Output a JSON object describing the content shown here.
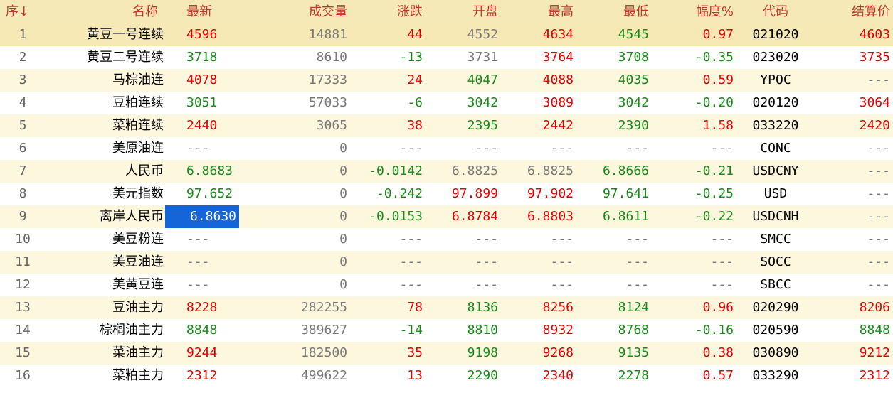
{
  "headers": [
    "序↓",
    "名称",
    "最新",
    "成交量",
    "涨跌",
    "开盘",
    "最高",
    "最低",
    "幅度%",
    "代码",
    "结算价"
  ],
  "colors": {
    "up": "#e60000",
    "down": "#1a8a1a",
    "neutral": "#7a7a7a",
    "header": "#c0392b",
    "selected": "#1565d8"
  },
  "rows": [
    {
      "seq": "1",
      "name": "黄豆一号连续",
      "latest": "4596",
      "volume": "14881",
      "change": "44",
      "open": "4552",
      "high": "4634",
      "low": "4545",
      "range": "0.97",
      "code": "021020",
      "settle": "4603",
      "c": {
        "latest": "red",
        "change": "red",
        "open": "gray",
        "high": "red",
        "low": "green",
        "range": "red",
        "settle": "red"
      }
    },
    {
      "seq": "2",
      "name": "黄豆二号连续",
      "latest": "3718",
      "volume": "8610",
      "change": "-13",
      "open": "3731",
      "high": "3764",
      "low": "3708",
      "range": "-0.35",
      "code": "023020",
      "settle": "3735",
      "c": {
        "latest": "green",
        "change": "green",
        "open": "gray",
        "high": "red",
        "low": "green",
        "range": "green",
        "settle": "red"
      }
    },
    {
      "seq": "3",
      "name": "马棕油连",
      "latest": "4078",
      "volume": "17333",
      "change": "24",
      "open": "4047",
      "high": "4088",
      "low": "4035",
      "range": "0.59",
      "code": "YPOC",
      "settle": "---",
      "c": {
        "latest": "red",
        "change": "red",
        "open": "green",
        "high": "red",
        "low": "green",
        "range": "red",
        "settle": "gray"
      }
    },
    {
      "seq": "4",
      "name": "豆粕连续",
      "latest": "3051",
      "volume": "57033",
      "change": "-6",
      "open": "3042",
      "high": "3089",
      "low": "3042",
      "range": "-0.20",
      "code": "020120",
      "settle": "3064",
      "c": {
        "latest": "green",
        "change": "green",
        "open": "green",
        "high": "red",
        "low": "green",
        "range": "green",
        "settle": "red"
      }
    },
    {
      "seq": "5",
      "name": "菜粕连续",
      "latest": "2440",
      "volume": "3065",
      "change": "38",
      "open": "2395",
      "high": "2442",
      "low": "2390",
      "range": "1.58",
      "code": "033220",
      "settle": "2420",
      "c": {
        "latest": "red",
        "change": "red",
        "open": "green",
        "high": "red",
        "low": "green",
        "range": "red",
        "settle": "red"
      }
    },
    {
      "seq": "6",
      "name": "美原油连",
      "latest": "---",
      "volume": "0",
      "change": "---",
      "open": "---",
      "high": "---",
      "low": "---",
      "range": "---",
      "code": "CONC",
      "settle": "---",
      "c": {
        "latest": "gray",
        "change": "gray",
        "open": "gray",
        "high": "gray",
        "low": "gray",
        "range": "gray",
        "settle": "gray"
      }
    },
    {
      "seq": "7",
      "name": "人民币",
      "latest": "6.8683",
      "volume": "0",
      "change": "-0.0142",
      "open": "6.8825",
      "high": "6.8825",
      "low": "6.8666",
      "range": "-0.21",
      "code": "USDCNY",
      "settle": "---",
      "c": {
        "latest": "green",
        "change": "green",
        "open": "gray",
        "high": "gray",
        "low": "green",
        "range": "green",
        "settle": "gray"
      }
    },
    {
      "seq": "8",
      "name": "美元指数",
      "latest": "97.652",
      "volume": "0",
      "change": "-0.242",
      "open": "97.899",
      "high": "97.902",
      "low": "97.641",
      "range": "-0.25",
      "code": "USD",
      "settle": "---",
      "c": {
        "latest": "green",
        "change": "green",
        "open": "red",
        "high": "red",
        "low": "green",
        "range": "green",
        "settle": "gray"
      }
    },
    {
      "seq": "9",
      "name": "离岸人民币",
      "latest": "6.8630",
      "volume": "0",
      "change": "-0.0153",
      "open": "6.8784",
      "high": "6.8803",
      "low": "6.8611",
      "range": "-0.22",
      "code": "USDCNH",
      "settle": "---",
      "c": {
        "latest": "hl",
        "change": "green",
        "open": "red",
        "high": "red",
        "low": "green",
        "range": "green",
        "settle": "gray"
      }
    },
    {
      "seq": "10",
      "name": "美豆粉连",
      "latest": "---",
      "volume": "0",
      "change": "---",
      "open": "---",
      "high": "---",
      "low": "---",
      "range": "---",
      "code": "SMCC",
      "settle": "---",
      "c": {
        "latest": "gray",
        "change": "gray",
        "open": "gray",
        "high": "gray",
        "low": "gray",
        "range": "gray",
        "settle": "gray"
      }
    },
    {
      "seq": "11",
      "name": "美豆油连",
      "latest": "---",
      "volume": "0",
      "change": "---",
      "open": "---",
      "high": "---",
      "low": "---",
      "range": "---",
      "code": "SOCC",
      "settle": "---",
      "c": {
        "latest": "gray",
        "change": "gray",
        "open": "gray",
        "high": "gray",
        "low": "gray",
        "range": "gray",
        "settle": "gray"
      }
    },
    {
      "seq": "12",
      "name": "美黄豆连",
      "latest": "---",
      "volume": "0",
      "change": "---",
      "open": "---",
      "high": "---",
      "low": "---",
      "range": "---",
      "code": "SBCC",
      "settle": "---",
      "c": {
        "latest": "gray",
        "change": "gray",
        "open": "gray",
        "high": "gray",
        "low": "gray",
        "range": "gray",
        "settle": "gray"
      }
    },
    {
      "seq": "13",
      "name": "豆油主力",
      "latest": "8228",
      "volume": "282255",
      "change": "78",
      "open": "8136",
      "high": "8256",
      "low": "8124",
      "range": "0.96",
      "code": "020290",
      "settle": "8206",
      "c": {
        "latest": "red",
        "change": "red",
        "open": "green",
        "high": "red",
        "low": "green",
        "range": "red",
        "settle": "red"
      }
    },
    {
      "seq": "14",
      "name": "棕榈油主力",
      "latest": "8848",
      "volume": "389627",
      "change": "-14",
      "open": "8810",
      "high": "8932",
      "low": "8768",
      "range": "-0.16",
      "code": "020590",
      "settle": "8848",
      "c": {
        "latest": "green",
        "change": "green",
        "open": "green",
        "high": "red",
        "low": "green",
        "range": "green",
        "settle": "green"
      }
    },
    {
      "seq": "15",
      "name": "菜油主力",
      "latest": "9244",
      "volume": "182500",
      "change": "35",
      "open": "9198",
      "high": "9268",
      "low": "9135",
      "range": "0.38",
      "code": "030890",
      "settle": "9212",
      "c": {
        "latest": "red",
        "change": "red",
        "open": "green",
        "high": "red",
        "low": "green",
        "range": "red",
        "settle": "red"
      }
    },
    {
      "seq": "16",
      "name": "菜粕主力",
      "latest": "2312",
      "volume": "499622",
      "change": "13",
      "open": "2290",
      "high": "2340",
      "low": "2278",
      "range": "0.57",
      "code": "033290",
      "settle": "2312",
      "c": {
        "latest": "red",
        "change": "red",
        "open": "green",
        "high": "red",
        "low": "green",
        "range": "red",
        "settle": "red"
      }
    }
  ]
}
